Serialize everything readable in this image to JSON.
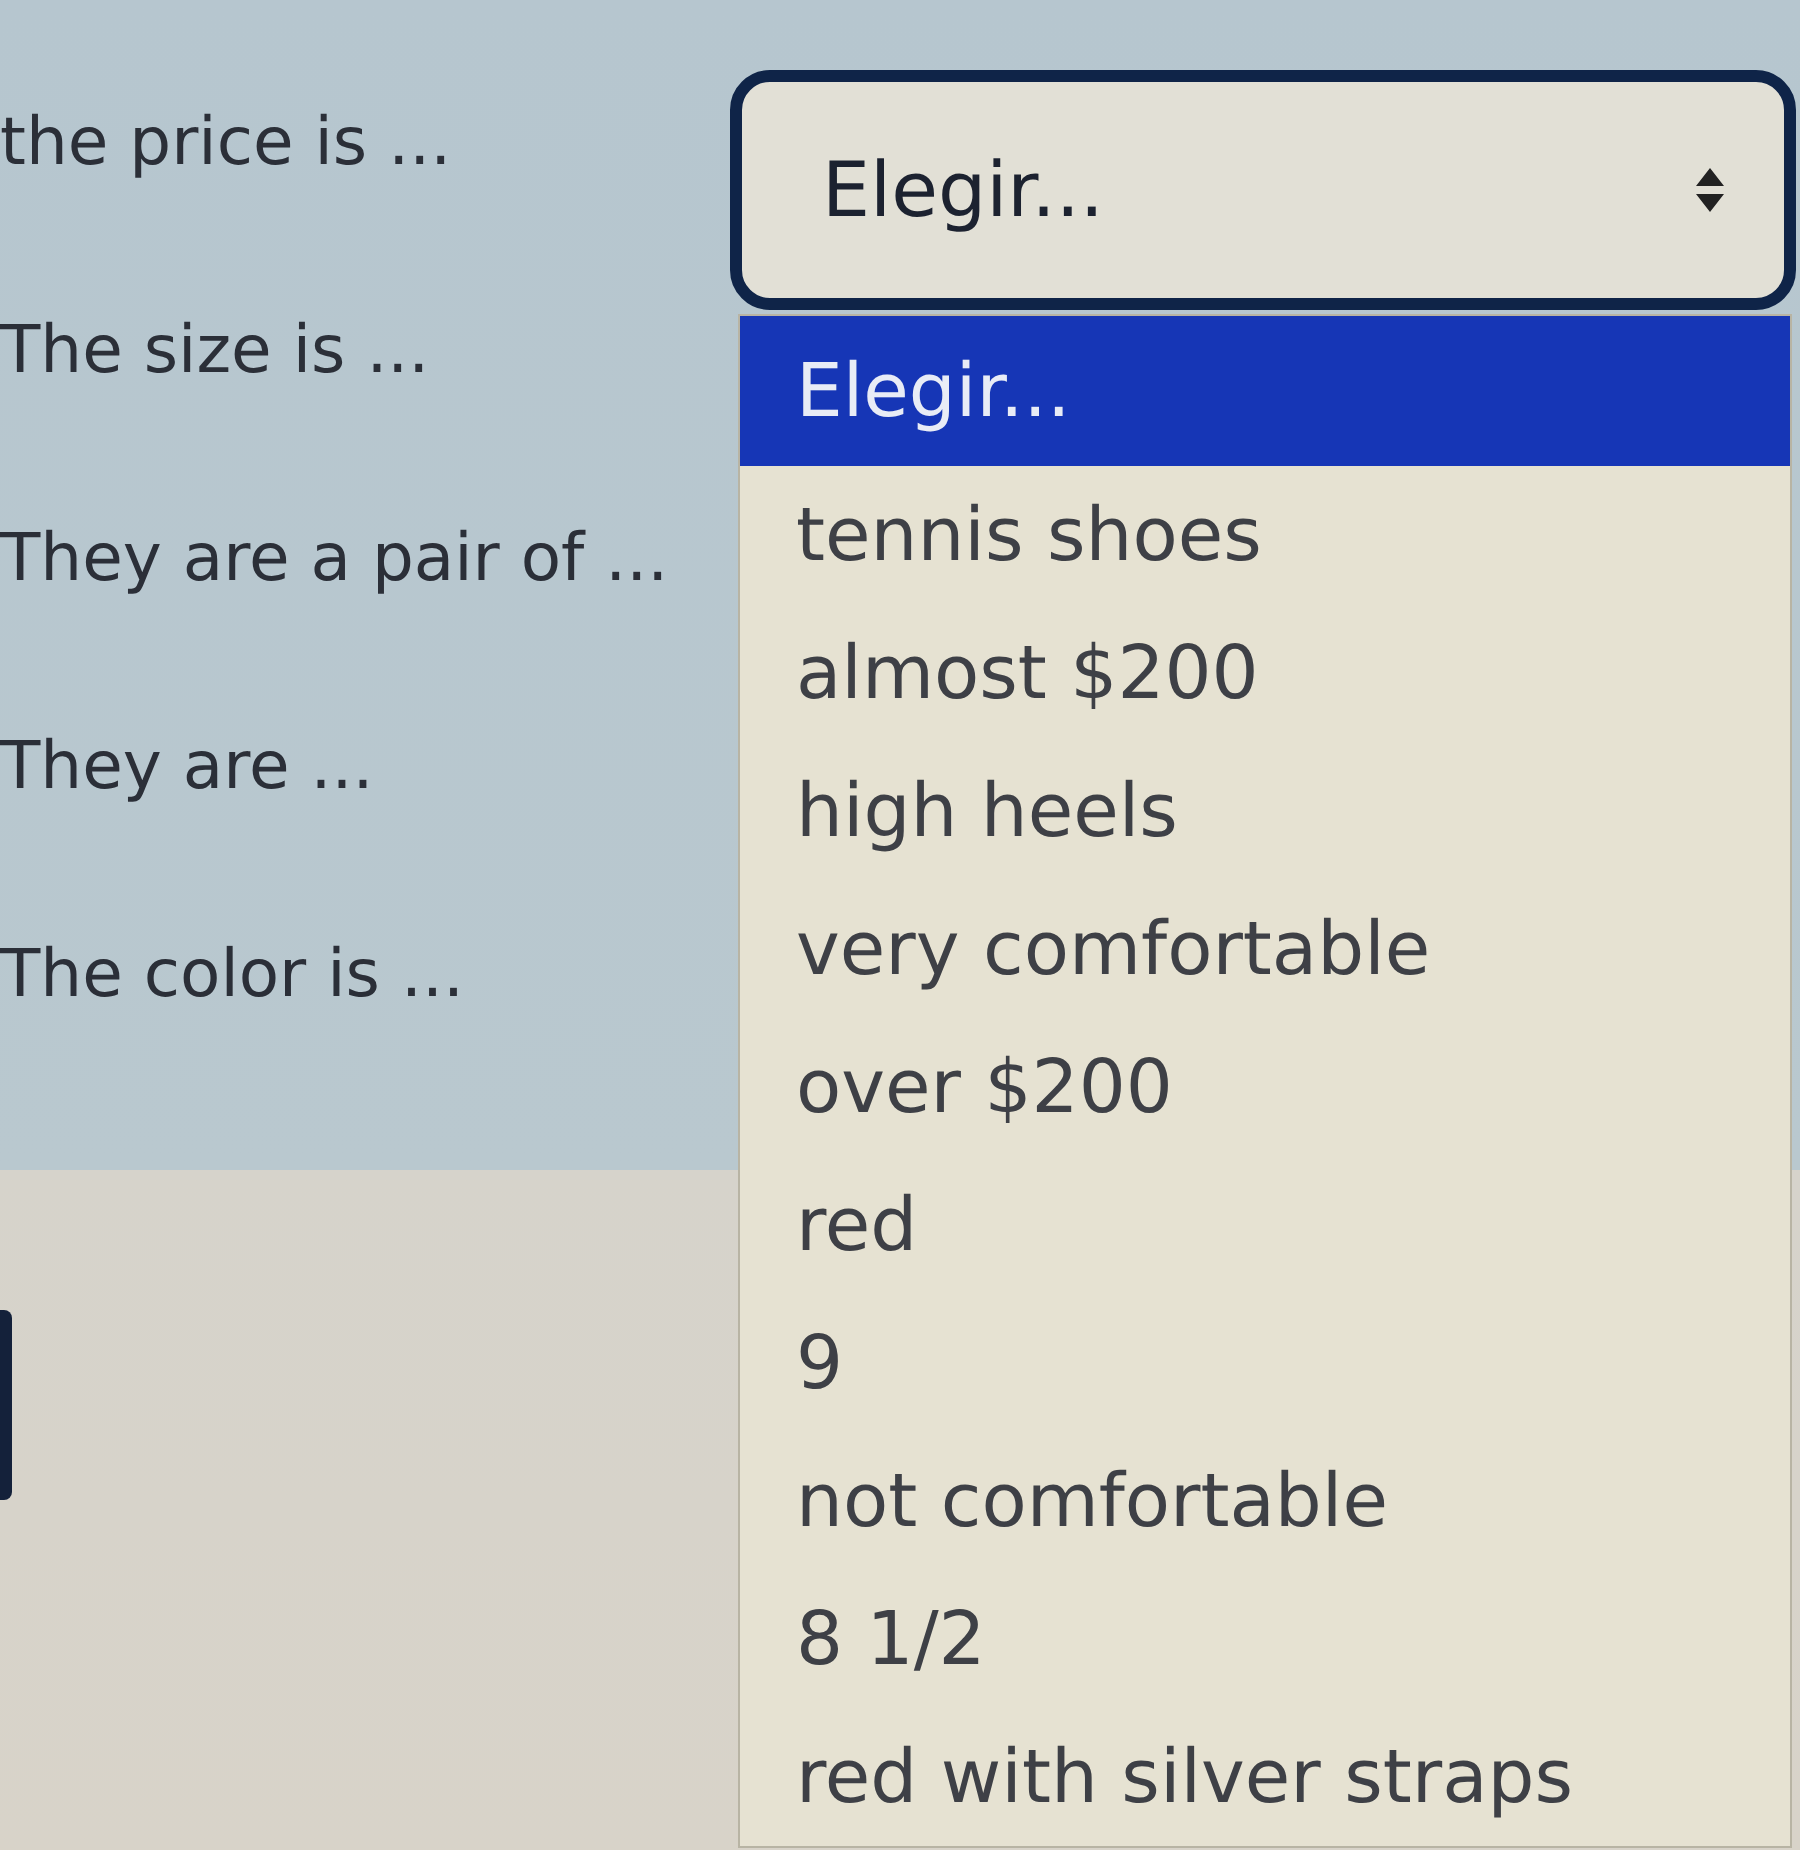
{
  "questions": [
    {
      "label": "the price is ..."
    },
    {
      "label": "The size is ..."
    },
    {
      "label": "They are a pair of ..."
    },
    {
      "label": "They are ..."
    },
    {
      "label": "The color is ..."
    }
  ],
  "select": {
    "value": "Elegir...",
    "expanded": true,
    "options": [
      {
        "label": "Elegir...",
        "selected": true
      },
      {
        "label": "tennis shoes",
        "selected": false
      },
      {
        "label": "almost $200",
        "selected": false
      },
      {
        "label": "high heels",
        "selected": false
      },
      {
        "label": "very comfortable",
        "selected": false
      },
      {
        "label": "over $200",
        "selected": false
      },
      {
        "label": "red",
        "selected": false
      },
      {
        "label": "9",
        "selected": false
      },
      {
        "label": "not comfortable",
        "selected": false
      },
      {
        "label": "8 1/2",
        "selected": false
      },
      {
        "label": "red with silver straps",
        "selected": false
      }
    ]
  }
}
